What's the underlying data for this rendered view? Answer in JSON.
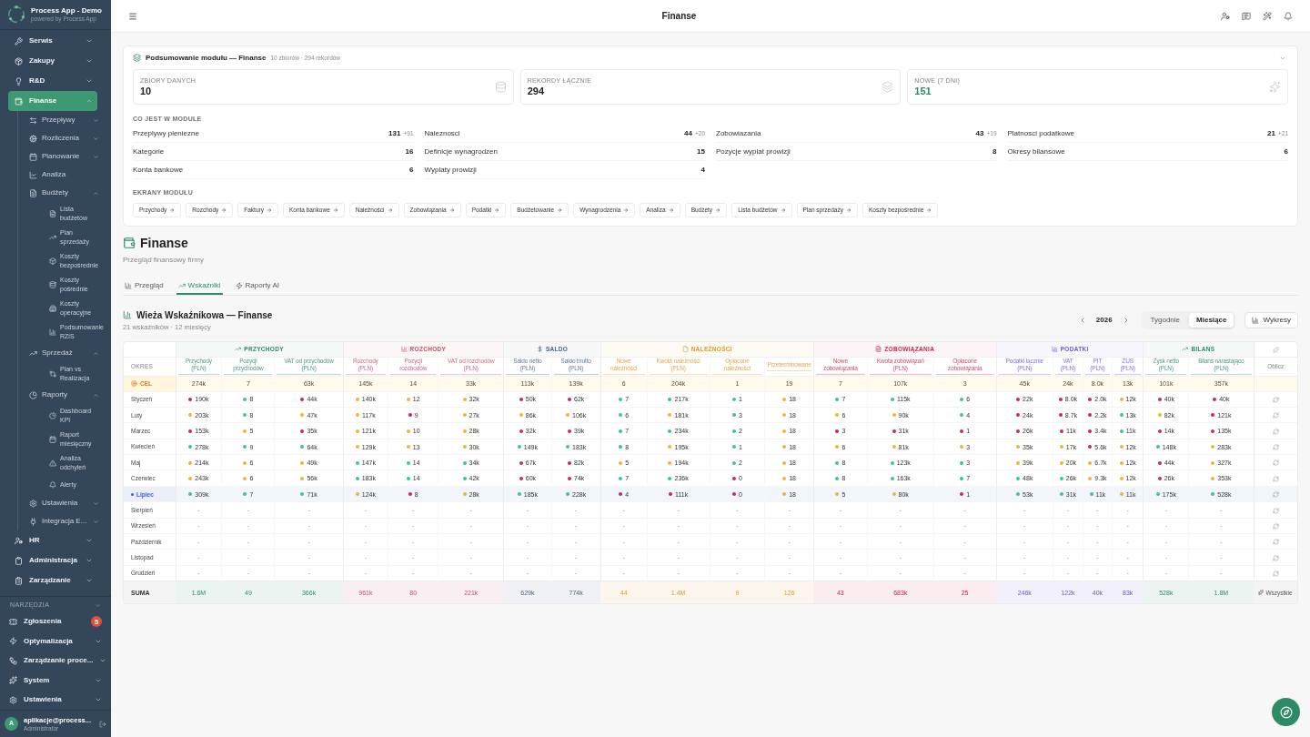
{
  "sidebar": {
    "brand": {
      "title": "Process App - Demo",
      "subtitle": "powered by Process App"
    },
    "nav": [
      {
        "label": "Serwis",
        "kind": "group",
        "expanded": false,
        "selected": false
      },
      {
        "label": "Zakupy",
        "kind": "group",
        "expanded": false,
        "selected": false
      },
      {
        "label": "R&D",
        "kind": "group",
        "expanded": false,
        "selected": false
      },
      {
        "label": "Finanse",
        "kind": "group",
        "expanded": true,
        "selected": true,
        "children": [
          {
            "label": "Przepływy",
            "kind": "group",
            "expanded": false,
            "selected": false
          },
          {
            "label": "Rozliczenia",
            "kind": "group",
            "expanded": false,
            "selected": false
          },
          {
            "label": "Planowanie",
            "kind": "group",
            "expanded": false,
            "selected": false
          },
          {
            "label": "Analiza",
            "kind": "link",
            "selected": false
          },
          {
            "label": "Budżety",
            "kind": "group",
            "expanded": true,
            "selected": false,
            "children": [
              {
                "label": "Lista budżetów",
                "kind": "link",
                "selected": false
              },
              {
                "label": "Plan sprzedaży",
                "kind": "link",
                "selected": false
              },
              {
                "label": "Koszty bezpośrednie",
                "kind": "link",
                "selected": false
              },
              {
                "label": "Koszty pośrednie",
                "kind": "link",
                "selected": false
              },
              {
                "label": "Koszty operacyjne",
                "kind": "link",
                "selected": false
              },
              {
                "label": "Podsumowanie RZiS",
                "kind": "link",
                "selected": false
              }
            ]
          },
          {
            "label": "Sprzedaż",
            "kind": "group",
            "expanded": true,
            "selected": false,
            "children": [
              {
                "label": "Plan vs Realizacja",
                "kind": "link",
                "selected": false
              }
            ]
          },
          {
            "label": "Raporty",
            "kind": "group",
            "expanded": true,
            "selected": false,
            "children": [
              {
                "label": "Dashboard KPI",
                "kind": "link",
                "selected": false
              },
              {
                "label": "Raport miesięczny",
                "kind": "link",
                "selected": false
              },
              {
                "label": "Analiza odchyleń",
                "kind": "link",
                "selected": false
              },
              {
                "label": "Alerty",
                "kind": "link",
                "selected": false
              }
            ]
          },
          {
            "label": "Ustawienia",
            "kind": "group",
            "expanded": false,
            "selected": false
          },
          {
            "label": "Integracja E...",
            "kind": "group",
            "expanded": false,
            "selected": false
          }
        ]
      },
      {
        "label": "HR",
        "kind": "group",
        "expanded": false,
        "selected": false
      },
      {
        "label": "Administracja",
        "kind": "group",
        "expanded": false,
        "selected": false
      },
      {
        "label": "Zarządzanie",
        "kind": "group",
        "expanded": false,
        "selected": false
      }
    ],
    "tools": {
      "label": "NARZĘDZIA",
      "items": [
        {
          "label": "Zgłoszenia",
          "kind": "link",
          "badge": "5",
          "selected": false
        },
        {
          "label": "Optymalizacja",
          "kind": "group",
          "expanded": false,
          "selected": false
        },
        {
          "label": "Zarządzanie proce...",
          "kind": "group",
          "expanded": false,
          "selected": false
        },
        {
          "label": "System",
          "kind": "group",
          "expanded": false,
          "selected": false
        },
        {
          "label": "Ustawienia",
          "kind": "group",
          "expanded": false,
          "selected": false
        }
      ]
    },
    "user": {
      "avatar": "A",
      "name": "aplikacje@process...",
      "role": "Administrator"
    }
  },
  "topbar": {
    "title": "Finanse"
  },
  "summary": {
    "title": "Podsumowanie modułu — Finanse",
    "meta": "10 zbiorów · 294 rekordów",
    "stats": [
      {
        "label": "ZBIORY DANYCH",
        "value": "10",
        "highlight": false
      },
      {
        "label": "REKORDY ŁĄCZNIE",
        "value": "294",
        "highlight": false
      },
      {
        "label": "NOWE (7 DNI)",
        "value": "151",
        "highlight": true
      }
    ],
    "contents_label": "CO JEST W MODULE",
    "contents": [
      {
        "name": "Przeplywy pieniezne",
        "count": "131",
        "delta": "+91"
      },
      {
        "name": "Naleznosci",
        "count": "44",
        "delta": "+20"
      },
      {
        "name": "Zobowiazania",
        "count": "43",
        "delta": "+19"
      },
      {
        "name": "Platnosci podatkowe",
        "count": "21",
        "delta": "+21"
      },
      {
        "name": "Kategorie",
        "count": "16"
      },
      {
        "name": "Definicje wynagrodzen",
        "count": "15"
      },
      {
        "name": "Pozycje wyplat prowizji",
        "count": "8"
      },
      {
        "name": "Okresy bilansowe",
        "count": "6"
      },
      {
        "name": "Konta bankowe",
        "count": "6"
      },
      {
        "name": "Wyplaty prowizji",
        "count": "4"
      }
    ],
    "screens_label": "EKRANY MODUŁU",
    "screens": [
      "Przychody",
      "Rozchody",
      "Faktury",
      "Konta bankowe",
      "Należności",
      "Zobowiązania",
      "Podatki",
      "Budżetowanie",
      "Wynagrodzenia",
      "Analiza",
      "Budżety",
      "Lista budżetów",
      "Plan sprzedaży",
      "Koszty bezpośrednie"
    ]
  },
  "page": {
    "title": "Finanse",
    "subtitle": "Przegląd finansowy firmy",
    "tabs": [
      {
        "label": "Przegląd",
        "selected": false
      },
      {
        "label": "Wskaźniki",
        "selected": true
      },
      {
        "label": "Raporty AI",
        "selected": false
      }
    ]
  },
  "tower": {
    "title": "Wieża Wskaźnikowa — Finanse",
    "subtitle": "21 wskaźników · 12 miesięcy",
    "year": "2026",
    "periods": [
      {
        "label": "Tygodnie",
        "selected": false
      },
      {
        "label": "Miesiące",
        "selected": true
      }
    ],
    "charts_button": "Wykresy",
    "table": {
      "period_header": "OKRES",
      "action_header": "Oblicz",
      "groups": [
        {
          "label": "PRZYCHODY",
          "color": "#2f8a66",
          "columns": [
            "Przychody (PLN)",
            "Pozycji przychodów",
            "VAT od przychodów (PLN)"
          ]
        },
        {
          "label": "ROZCHODY",
          "color": "#c24d6b",
          "columns": [
            "Rozchody (PLN)",
            "Pozycji rozchodów",
            "VAT od rozchodów (PLN)"
          ]
        },
        {
          "label": "SALDO",
          "color": "#4a6386",
          "columns": [
            "Saldo netto (PLN)",
            "Saldo brutto (PLN)"
          ]
        },
        {
          "label": "NALEŻNOŚCI",
          "color": "#e09a2e",
          "columns": [
            "Nowe należności",
            "Kwota należności (PLN)",
            "Opłacone należności",
            "Przeterminowane"
          ]
        },
        {
          "label": "ZOBOWIĄZANIA",
          "color": "#c8284c",
          "columns": [
            "Nowe zobowiązania",
            "Kwota zobowiązań (PLN)",
            "Opłacone zobowiązania"
          ]
        },
        {
          "label": "PODATKI",
          "color": "#7155d8",
          "columns": [
            "Podatki łącznie (PLN)",
            "VAT (PLN)",
            "PIT (PLN)",
            "ZUS (PLN)"
          ]
        },
        {
          "label": "BILANS",
          "color": "#2f8a66",
          "columns": [
            "Zysk netto (PLN)",
            "Bilans narastająco (PLN)"
          ]
        }
      ],
      "target": {
        "label": "CEL",
        "values": [
          "274k",
          "7",
          "63k",
          "145k",
          "14",
          "33k",
          "113k",
          "139k",
          "6",
          "204k",
          "1",
          "19",
          "7",
          "107k",
          "3",
          "45k",
          "24k",
          "8.0k",
          "13k",
          "101k",
          "357k"
        ]
      },
      "rows": [
        {
          "period": "Styczeń",
          "current": false,
          "cells": [
            {
              "value": "190k",
              "color": "#c92a52"
            },
            {
              "value": "8",
              "color": "#3cc68a"
            },
            {
              "value": "44k",
              "color": "#c92a52"
            },
            {
              "value": "140k",
              "color": "#e6b83a"
            },
            {
              "value": "12",
              "color": "#e6b83a"
            },
            {
              "value": "32k",
              "color": "#e6b83a"
            },
            {
              "value": "50k",
              "color": "#c92a52"
            },
            {
              "value": "62k",
              "color": "#c92a52"
            },
            {
              "value": "7",
              "color": "#3cc68a"
            },
            {
              "value": "217k",
              "color": "#3cc68a"
            },
            {
              "value": "1",
              "color": "#3cc68a"
            },
            {
              "value": "18",
              "color": "#e6b83a"
            },
            {
              "value": "7",
              "color": "#3cc68a"
            },
            {
              "value": "115k",
              "color": "#3cc68a"
            },
            {
              "value": "6",
              "color": "#3cc68a"
            },
            {
              "value": "22k",
              "color": "#c92a52"
            },
            {
              "value": "8.0k",
              "color": "#c92a52"
            },
            {
              "value": "2.0k",
              "color": "#c92a52"
            },
            {
              "value": "12k",
              "color": "#e6b83a"
            },
            {
              "value": "40k",
              "color": "#c92a52"
            },
            {
              "value": "40k",
              "color": "#c92a52"
            }
          ]
        },
        {
          "period": "Luty",
          "current": false,
          "cells": [
            {
              "value": "203k",
              "color": "#e6b83a"
            },
            {
              "value": "8",
              "color": "#3cc68a"
            },
            {
              "value": "47k",
              "color": "#e6b83a"
            },
            {
              "value": "117k",
              "color": "#e6b83a"
            },
            {
              "value": "9",
              "color": "#c92a52"
            },
            {
              "value": "27k",
              "color": "#e6b83a"
            },
            {
              "value": "86k",
              "color": "#e6b83a"
            },
            {
              "value": "106k",
              "color": "#e6b83a"
            },
            {
              "value": "6",
              "color": "#3cc68a"
            },
            {
              "value": "181k",
              "color": "#e6b83a"
            },
            {
              "value": "3",
              "color": "#3cc68a"
            },
            {
              "value": "18",
              "color": "#e6b83a"
            },
            {
              "value": "6",
              "color": "#e6b83a"
            },
            {
              "value": "90k",
              "color": "#e6b83a"
            },
            {
              "value": "4",
              "color": "#3cc68a"
            },
            {
              "value": "24k",
              "color": "#c92a52"
            },
            {
              "value": "8.7k",
              "color": "#c92a52"
            },
            {
              "value": "2.2k",
              "color": "#c92a52"
            },
            {
              "value": "13k",
              "color": "#3cc68a"
            },
            {
              "value": "82k",
              "color": "#e6b83a"
            },
            {
              "value": "121k",
              "color": "#c92a52"
            }
          ]
        },
        {
          "period": "Marzec",
          "current": false,
          "cells": [
            {
              "value": "153k",
              "color": "#c92a52"
            },
            {
              "value": "5",
              "color": "#e6b83a"
            },
            {
              "value": "35k",
              "color": "#c92a52"
            },
            {
              "value": "121k",
              "color": "#e6b83a"
            },
            {
              "value": "10",
              "color": "#e6b83a"
            },
            {
              "value": "28k",
              "color": "#e6b83a"
            },
            {
              "value": "32k",
              "color": "#c92a52"
            },
            {
              "value": "39k",
              "color": "#c92a52"
            },
            {
              "value": "7",
              "color": "#3cc68a"
            },
            {
              "value": "234k",
              "color": "#3cc68a"
            },
            {
              "value": "2",
              "color": "#3cc68a"
            },
            {
              "value": "18",
              "color": "#e6b83a"
            },
            {
              "value": "3",
              "color": "#c92a52"
            },
            {
              "value": "31k",
              "color": "#c92a52"
            },
            {
              "value": "1",
              "color": "#c92a52"
            },
            {
              "value": "26k",
              "color": "#c92a52"
            },
            {
              "value": "11k",
              "color": "#c92a52"
            },
            {
              "value": "3.4k",
              "color": "#c92a52"
            },
            {
              "value": "11k",
              "color": "#3cc68a"
            },
            {
              "value": "14k",
              "color": "#c92a52"
            },
            {
              "value": "135k",
              "color": "#c92a52"
            }
          ]
        },
        {
          "period": "Kwiecień",
          "current": false,
          "cells": [
            {
              "value": "278k",
              "color": "#3cc68a"
            },
            {
              "value": "9",
              "color": "#3cc68a"
            },
            {
              "value": "64k",
              "color": "#3cc68a"
            },
            {
              "value": "129k",
              "color": "#e6b83a"
            },
            {
              "value": "13",
              "color": "#e6b83a"
            },
            {
              "value": "30k",
              "color": "#e6b83a"
            },
            {
              "value": "149k",
              "color": "#3cc68a"
            },
            {
              "value": "183k",
              "color": "#3cc68a"
            },
            {
              "value": "8",
              "color": "#3cc68a"
            },
            {
              "value": "195k",
              "color": "#e6b83a"
            },
            {
              "value": "1",
              "color": "#3cc68a"
            },
            {
              "value": "18",
              "color": "#e6b83a"
            },
            {
              "value": "6",
              "color": "#e6b83a"
            },
            {
              "value": "81k",
              "color": "#e6b83a"
            },
            {
              "value": "3",
              "color": "#e6b83a"
            },
            {
              "value": "35k",
              "color": "#e6b83a"
            },
            {
              "value": "17k",
              "color": "#e6b83a"
            },
            {
              "value": "5.6k",
              "color": "#c92a52"
            },
            {
              "value": "12k",
              "color": "#e6b83a"
            },
            {
              "value": "148k",
              "color": "#3cc68a"
            },
            {
              "value": "283k",
              "color": "#e6b83a"
            }
          ]
        },
        {
          "period": "Maj",
          "current": false,
          "cells": [
            {
              "value": "214k",
              "color": "#e6b83a"
            },
            {
              "value": "6",
              "color": "#e6b83a"
            },
            {
              "value": "49k",
              "color": "#e6b83a"
            },
            {
              "value": "147k",
              "color": "#3cc68a"
            },
            {
              "value": "14",
              "color": "#3cc68a"
            },
            {
              "value": "34k",
              "color": "#3cc68a"
            },
            {
              "value": "67k",
              "color": "#c92a52"
            },
            {
              "value": "82k",
              "color": "#c92a52"
            },
            {
              "value": "5",
              "color": "#e6b83a"
            },
            {
              "value": "194k",
              "color": "#e6b83a"
            },
            {
              "value": "2",
              "color": "#3cc68a"
            },
            {
              "value": "18",
              "color": "#e6b83a"
            },
            {
              "value": "8",
              "color": "#3cc68a"
            },
            {
              "value": "123k",
              "color": "#3cc68a"
            },
            {
              "value": "3",
              "color": "#3cc68a"
            },
            {
              "value": "39k",
              "color": "#e6b83a"
            },
            {
              "value": "20k",
              "color": "#e6b83a"
            },
            {
              "value": "6.7k",
              "color": "#e6b83a"
            },
            {
              "value": "12k",
              "color": "#e6b83a"
            },
            {
              "value": "44k",
              "color": "#c92a52"
            },
            {
              "value": "327k",
              "color": "#e6b83a"
            }
          ]
        },
        {
          "period": "Czerwiec",
          "current": false,
          "cells": [
            {
              "value": "243k",
              "color": "#e6b83a"
            },
            {
              "value": "6",
              "color": "#e6b83a"
            },
            {
              "value": "56k",
              "color": "#e6b83a"
            },
            {
              "value": "183k",
              "color": "#3cc68a"
            },
            {
              "value": "14",
              "color": "#3cc68a"
            },
            {
              "value": "42k",
              "color": "#3cc68a"
            },
            {
              "value": "60k",
              "color": "#c92a52"
            },
            {
              "value": "74k",
              "color": "#c92a52"
            },
            {
              "value": "7",
              "color": "#3cc68a"
            },
            {
              "value": "236k",
              "color": "#3cc68a"
            },
            {
              "value": "0",
              "color": "#c92a52"
            },
            {
              "value": "18",
              "color": "#e6b83a"
            },
            {
              "value": "8",
              "color": "#3cc68a"
            },
            {
              "value": "163k",
              "color": "#3cc68a"
            },
            {
              "value": "7",
              "color": "#3cc68a"
            },
            {
              "value": "48k",
              "color": "#3cc68a"
            },
            {
              "value": "26k",
              "color": "#3cc68a"
            },
            {
              "value": "9.3k",
              "color": "#e6b83a"
            },
            {
              "value": "12k",
              "color": "#e6b83a"
            },
            {
              "value": "26k",
              "color": "#c92a52"
            },
            {
              "value": "353k",
              "color": "#e6b83a"
            }
          ]
        },
        {
          "period": "Lipiec",
          "current": true,
          "cells": [
            {
              "value": "309k",
              "color": "#3cc68a"
            },
            {
              "value": "7",
              "color": "#3cc68a"
            },
            {
              "value": "71k",
              "color": "#3cc68a"
            },
            {
              "value": "124k",
              "color": "#e6b83a"
            },
            {
              "value": "8",
              "color": "#c92a52"
            },
            {
              "value": "28k",
              "color": "#e6b83a"
            },
            {
              "value": "185k",
              "color": "#3cc68a"
            },
            {
              "value": "228k",
              "color": "#3cc68a"
            },
            {
              "value": "4",
              "color": "#c92a52"
            },
            {
              "value": "111k",
              "color": "#c92a52"
            },
            {
              "value": "0",
              "color": "#c92a52"
            },
            {
              "value": "18",
              "color": "#e6b83a"
            },
            {
              "value": "5",
              "color": "#e6b83a"
            },
            {
              "value": "80k",
              "color": "#e6b83a"
            },
            {
              "value": "1",
              "color": "#c92a52"
            },
            {
              "value": "53k",
              "color": "#3cc68a"
            },
            {
              "value": "31k",
              "color": "#3cc68a"
            },
            {
              "value": "11k",
              "color": "#3cc68a"
            },
            {
              "value": "11k",
              "color": "#e6b83a"
            },
            {
              "value": "175k",
              "color": "#3cc68a"
            },
            {
              "value": "528k",
              "color": "#3cc68a"
            }
          ]
        },
        {
          "period": "Sierpień",
          "current": false,
          "cells": [
            {
              "value": "-"
            },
            {
              "value": "-"
            },
            {
              "value": "-"
            },
            {
              "value": "-"
            },
            {
              "value": "-"
            },
            {
              "value": "-"
            },
            {
              "value": "-"
            },
            {
              "value": "-"
            },
            {
              "value": "-"
            },
            {
              "value": "-"
            },
            {
              "value": "-"
            },
            {
              "value": "-"
            },
            {
              "value": "-"
            },
            {
              "value": "-"
            },
            {
              "value": "-"
            },
            {
              "value": "-"
            },
            {
              "value": "-"
            },
            {
              "value": "-"
            },
            {
              "value": "-"
            },
            {
              "value": "-"
            },
            {
              "value": "-"
            }
          ]
        },
        {
          "period": "Wrzesień",
          "current": false,
          "cells": [
            {
              "value": "-"
            },
            {
              "value": "-"
            },
            {
              "value": "-"
            },
            {
              "value": "-"
            },
            {
              "value": "-"
            },
            {
              "value": "-"
            },
            {
              "value": "-"
            },
            {
              "value": "-"
            },
            {
              "value": "-"
            },
            {
              "value": "-"
            },
            {
              "value": "-"
            },
            {
              "value": "-"
            },
            {
              "value": "-"
            },
            {
              "value": "-"
            },
            {
              "value": "-"
            },
            {
              "value": "-"
            },
            {
              "value": "-"
            },
            {
              "value": "-"
            },
            {
              "value": "-"
            },
            {
              "value": "-"
            },
            {
              "value": "-"
            }
          ]
        },
        {
          "period": "Październik",
          "current": false,
          "cells": [
            {
              "value": "-"
            },
            {
              "value": "-"
            },
            {
              "value": "-"
            },
            {
              "value": "-"
            },
            {
              "value": "-"
            },
            {
              "value": "-"
            },
            {
              "value": "-"
            },
            {
              "value": "-"
            },
            {
              "value": "-"
            },
            {
              "value": "-"
            },
            {
              "value": "-"
            },
            {
              "value": "-"
            },
            {
              "value": "-"
            },
            {
              "value": "-"
            },
            {
              "value": "-"
            },
            {
              "value": "-"
            },
            {
              "value": "-"
            },
            {
              "value": "-"
            },
            {
              "value": "-"
            },
            {
              "value": "-"
            },
            {
              "value": "-"
            }
          ]
        },
        {
          "period": "Listopad",
          "current": false,
          "cells": [
            {
              "value": "-"
            },
            {
              "value": "-"
            },
            {
              "value": "-"
            },
            {
              "value": "-"
            },
            {
              "value": "-"
            },
            {
              "value": "-"
            },
            {
              "value": "-"
            },
            {
              "value": "-"
            },
            {
              "value": "-"
            },
            {
              "value": "-"
            },
            {
              "value": "-"
            },
            {
              "value": "-"
            },
            {
              "value": "-"
            },
            {
              "value": "-"
            },
            {
              "value": "-"
            },
            {
              "value": "-"
            },
            {
              "value": "-"
            },
            {
              "value": "-"
            },
            {
              "value": "-"
            },
            {
              "value": "-"
            },
            {
              "value": "-"
            }
          ]
        },
        {
          "period": "Grudzień",
          "current": false,
          "cells": [
            {
              "value": "-"
            },
            {
              "value": "-"
            },
            {
              "value": "-"
            },
            {
              "value": "-"
            },
            {
              "value": "-"
            },
            {
              "value": "-"
            },
            {
              "value": "-"
            },
            {
              "value": "-"
            },
            {
              "value": "-"
            },
            {
              "value": "-"
            },
            {
              "value": "-"
            },
            {
              "value": "-"
            },
            {
              "value": "-"
            },
            {
              "value": "-"
            },
            {
              "value": "-"
            },
            {
              "value": "-"
            },
            {
              "value": "-"
            },
            {
              "value": "-"
            },
            {
              "value": "-"
            },
            {
              "value": "-"
            },
            {
              "value": "-"
            }
          ]
        }
      ],
      "total": {
        "label": "SUMA",
        "values": [
          "1.6M",
          "49",
          "366k",
          "961k",
          "80",
          "221k",
          "629k",
          "774k",
          "44",
          "1.4M",
          "9",
          "126",
          "43",
          "683k",
          "25",
          "246k",
          "122k",
          "40k",
          "83k",
          "528k",
          "1.8M"
        ],
        "action": "Wszystkie"
      }
    }
  }
}
